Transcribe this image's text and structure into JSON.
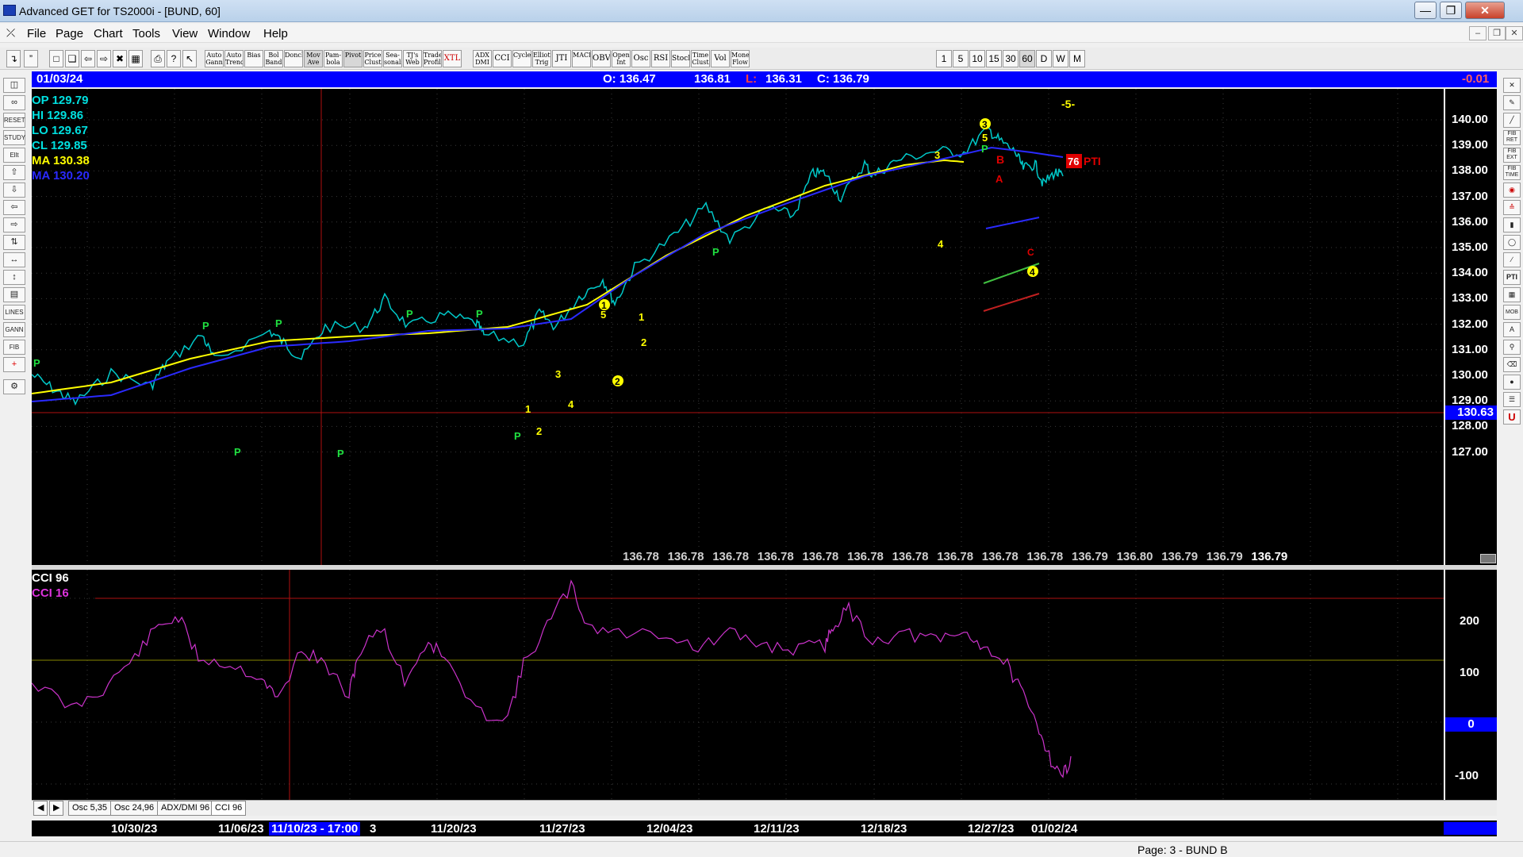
{
  "window": {
    "title": "Advanced GET for TS2000i - [BUND, 60]"
  },
  "menu": [
    "File",
    "Page",
    "Chart",
    "Tools",
    "View",
    "Window",
    "Help"
  ],
  "toolbar": {
    "buttons": [
      "Auto Gann",
      "Auto Trend",
      "Bias",
      "Bol Band",
      "Donch",
      "Mov Ave",
      "Pam-bola",
      "Pivot",
      "Price Clust",
      "Sea-sonals",
      "TJ's Web",
      "Trade Profile",
      "XTL",
      "ADX DMI",
      "CCI",
      "Cycles",
      "Elliott Trig",
      "JTI",
      "MACD",
      "OBV",
      "Open Int",
      "Osc",
      "RSI",
      "Stoch",
      "Time Clust",
      "Vol",
      "Money Flow"
    ],
    "intervals": [
      "1",
      "5",
      "10",
      "15",
      "30",
      "60",
      "D",
      "W",
      "M"
    ]
  },
  "right_tools": [
    "FIB RET",
    "FIB EXT",
    "FIB TIME",
    "PTI",
    "MOB"
  ],
  "infobar": {
    "date": "01/03/24",
    "open": "O: 136.47",
    "high": "136.81",
    "low_label": "L:",
    "low": "136.31",
    "close": "C: 136.79",
    "change": "-0.01"
  },
  "legend": {
    "op": "OP  129.79",
    "hi": "HI   129.86",
    "lo": "LO  129.67",
    "cl": "CL  129.85",
    "ma1": "MA  130.38",
    "ma2": "MA  130.20",
    "cci1": "CCI 96",
    "cci2": "CCI  16"
  },
  "price_axis": [
    "140.00",
    "139.00",
    "138.00",
    "137.00",
    "136.00",
    "135.00",
    "134.00",
    "133.00",
    "132.00",
    "131.00",
    "130.00",
    "129.00",
    "128.00",
    "127.00"
  ],
  "price_marker": "130.63",
  "cci_axis": [
    "200",
    "100",
    "0",
    "-100"
  ],
  "bottom_values": [
    "136.78",
    "136.78",
    "136.78",
    "136.78",
    "136.78",
    "136.78",
    "136.78",
    "136.78",
    "136.78",
    "136.78",
    "136.79",
    "136.80",
    "136.79",
    "136.79",
    "136.79"
  ],
  "annotations": {
    "wave5_label": "-5-",
    "pti_value": "76",
    "pti_text": "PTI",
    "p": "P",
    "a": "A",
    "b": "B",
    "c": "C",
    "waves": [
      "1",
      "2",
      "3",
      "4",
      "5"
    ]
  },
  "tabs": [
    "Osc 5,35",
    "Osc 24,96",
    "ADX/DMI 96",
    "CCI 96"
  ],
  "dates": [
    "10/30/23",
    "11/06/23",
    "11/10/23 - 17:00",
    "3",
    "11/20/23",
    "11/27/23",
    "12/04/23",
    "12/11/23",
    "12/18/23",
    "12/27/23",
    "01/02/24"
  ],
  "status": "Page: 3 - BUND B",
  "colors": {
    "chart_bg": "#000000",
    "price_line": "#00c8c8",
    "ma_yellow": "#ffff00",
    "ma_blue": "#2a2aff",
    "cci": "#cc33cc",
    "blue_bar": "#0000ff"
  }
}
